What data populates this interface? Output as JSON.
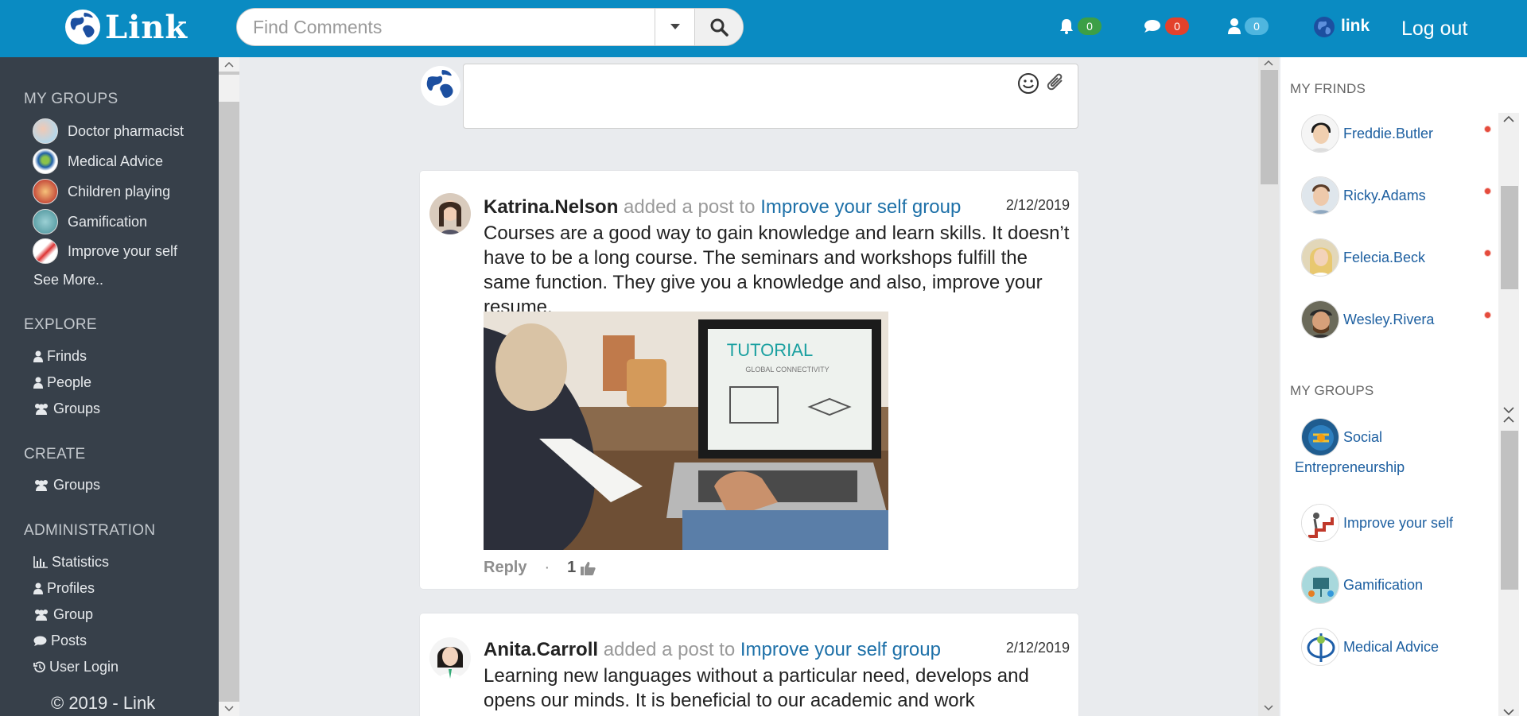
{
  "navbar": {
    "brand": "Link",
    "search_placeholder": "Find Comments",
    "notifications_count": "0",
    "messages_count": "0",
    "friend_requests_count": "0",
    "user_name": "link",
    "logout_label": "Log out",
    "colors": {
      "bar": "#0a8bc2",
      "notifications": "#3c9f46",
      "messages": "#e3412b",
      "requests": "#4fb6df"
    }
  },
  "sidebar": {
    "my_groups_heading": "MY GROUPS",
    "groups": [
      {
        "label": "Doctor pharmacist",
        "icon": "group-avatar"
      },
      {
        "label": "Medical Advice",
        "icon": "group-avatar"
      },
      {
        "label": "Children playing",
        "icon": "group-avatar"
      },
      {
        "label": "Gamification",
        "icon": "group-avatar"
      },
      {
        "label": "Improve your self",
        "icon": "group-avatar"
      }
    ],
    "see_more": "See More..",
    "explore_heading": "EXPLORE",
    "explore": [
      {
        "label": "Frinds",
        "icon": "user-icon"
      },
      {
        "label": "People",
        "icon": "user-icon"
      },
      {
        "label": "Groups",
        "icon": "users-icon"
      }
    ],
    "create_heading": "CREATE",
    "create": [
      {
        "label": "Groups",
        "icon": "users-icon"
      }
    ],
    "admin_heading": "ADMINISTRATION",
    "admin": [
      {
        "label": "Statistics",
        "icon": "bar-chart-icon"
      },
      {
        "label": "Profiles",
        "icon": "user-icon"
      },
      {
        "label": "Group",
        "icon": "users-icon"
      },
      {
        "label": "Posts",
        "icon": "comment-icon"
      },
      {
        "label": "User Login",
        "icon": "history-icon"
      }
    ],
    "copyright": "© 2019 - Link"
  },
  "posts": [
    {
      "author": "Katrina.Nelson",
      "verb": " added a post to ",
      "group": "Improve your self group",
      "date": "2/12/2019",
      "text": "Courses are a good way to gain knowledge and learn skills. It doesn’t have to be a long course. The seminars and workshops fulfill the same function. They give you a knowledge and also, improve your resume.",
      "image_caption_title": "TUTORIAL",
      "image_caption_sub": "GLOBAL CONNECTIVITY",
      "reply_label": "Reply",
      "separator": "·",
      "likes": "1"
    },
    {
      "author": "Anita.Carroll",
      "verb": " added a post to ",
      "group": "Improve your self group",
      "date": "2/12/2019",
      "text": "Learning new languages without a particular need, develops and opens our minds. It is beneficial to our academic and work"
    }
  ],
  "right_panel": {
    "friends_heading": "MY FRINDS",
    "friends": [
      {
        "name": "Freddie.Butler",
        "online": true
      },
      {
        "name": "Ricky.Adams",
        "online": true
      },
      {
        "name": "Felecia.Beck",
        "online": true
      },
      {
        "name": "Wesley.Rivera",
        "online": true
      }
    ],
    "groups_heading": "MY GROUPS",
    "groups": [
      {
        "name_line1": "Social",
        "name_line2": "Entrepreneurship"
      },
      {
        "name": "Improve your self"
      },
      {
        "name": "Gamification"
      },
      {
        "name": "Medical Advice"
      }
    ]
  }
}
